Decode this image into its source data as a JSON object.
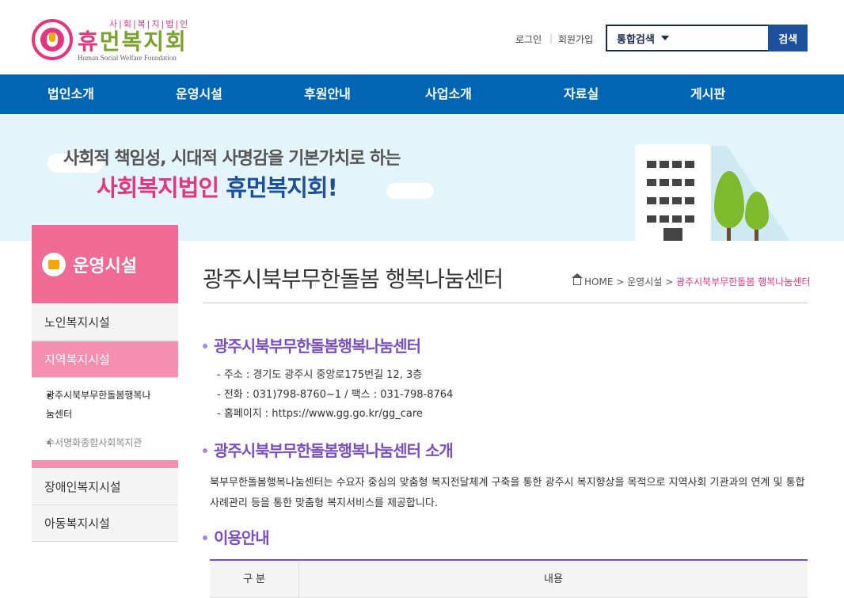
{
  "header": {
    "logo": {
      "sub": "사|회|복|지|법|인",
      "main_h": "휴",
      "main_rest": "먼복지회",
      "english": "Human Social Welfare Foundation"
    },
    "util": {
      "login": "로그인",
      "join": "회원가입"
    },
    "search": {
      "select_value": "통합검색",
      "button": "검색"
    }
  },
  "nav": {
    "items": [
      "법인소개",
      "운영시설",
      "후원안내",
      "사업소개",
      "자료실",
      "게시판"
    ]
  },
  "banner": {
    "line1": "사회적 책임성, 시대적 사명감을 기본가치로 하는",
    "line2_pink": "사회복지법인",
    "line2_blue": "휴먼복지회!"
  },
  "sidebar": {
    "title": "운영시설",
    "items": [
      "노인복지시설",
      "지역복지시설",
      "장애인복지시설",
      "아동복지시설"
    ],
    "sub_items": [
      "광주시북부무한돌봄행복나눔센터",
      "수서명화종합사회복지관"
    ],
    "sub_items_display": [
      "광주시북부무한돌봄행복나",
      "눔센터"
    ]
  },
  "main": {
    "title": "광주시북부무한돌봄 행복나눔센터",
    "breadcrumb": {
      "home": "HOME",
      "sep": ">",
      "level1": "운영시설",
      "current": "광주시북부무한돌봄 행복나눔센터"
    },
    "section1": {
      "title": "광주시북부무한돌봄행복나눔센터",
      "lines": [
        "- 주소 : 경기도 광주시 중앙로175번길 12, 3층",
        "- 전화 : 031)798-8760~1 / 팩스 : 031-798-8764",
        "- 홈페이지 : https://www.gg.go.kr/gg_care"
      ]
    },
    "section2": {
      "title": "광주시북부무한돌봄행복나눔센터 소개",
      "desc": "북부무한돌봄행복나눔센터는 수요자 중심의 맞춤형 복지전달체계 구축을 통한 광주시 복지향상을 목적으로 지역사회 기관과의 연계 및 통합사례관리 등을 통한 맞춤형 복지서비스를 제공합니다."
    },
    "section3": {
      "title": "이용안내",
      "table_headers": [
        "구 분",
        "내용"
      ]
    }
  },
  "colors": {
    "nav_bg": "#0066b3",
    "brand_pink": "#e6357e",
    "brand_blue": "#1c4f9c",
    "section_purple": "#7a4fbf",
    "sidebar_head": "#f06a96",
    "sidebar_active": "#f48fb1",
    "banner_bg": "#e3f4fa"
  }
}
